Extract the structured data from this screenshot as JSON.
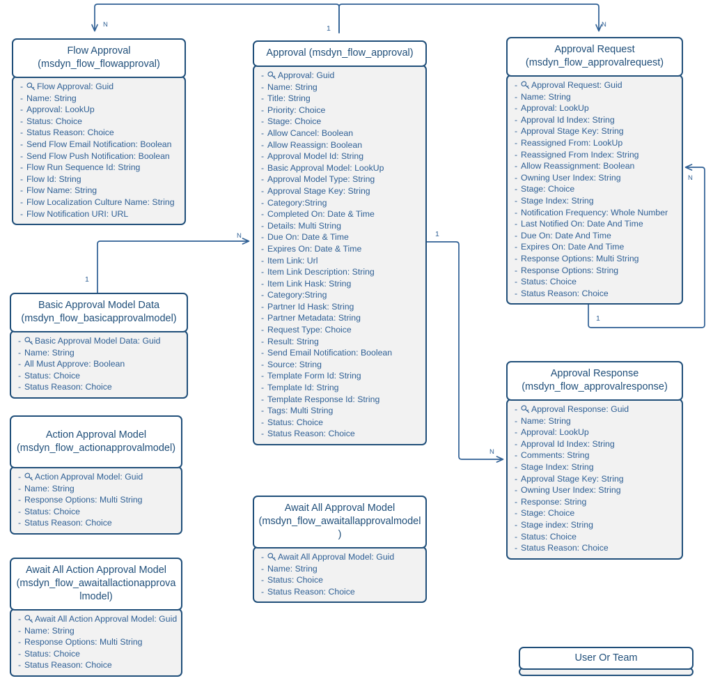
{
  "diagram": {
    "title": "Power Automate Approvals Dataverse ER Diagram",
    "colors": {
      "border": "#1F4E79",
      "header_bg": "#FFFFFF",
      "body_bg": "#F2F2F2",
      "text": "#2E5F94",
      "line": "#2E5F94"
    }
  },
  "entities": [
    {
      "id": "flow-approval",
      "title": "Flow Approval",
      "schema": "(msdyn_flow_flowapproval)",
      "attributes": [
        {
          "key": true,
          "text": "Flow Approval: Guid"
        },
        {
          "key": false,
          "text": "Name: String"
        },
        {
          "key": false,
          "text": "Approval: LookUp"
        },
        {
          "key": false,
          "text": "Status: Choice"
        },
        {
          "key": false,
          "text": "Status Reason: Choice"
        },
        {
          "key": false,
          "text": "Send Flow Email Notification: Boolean"
        },
        {
          "key": false,
          "text": "Send Flow Push Notification: Boolean"
        },
        {
          "key": false,
          "text": "Flow Run Sequence Id: String"
        },
        {
          "key": false,
          "text": "Flow Id: String"
        },
        {
          "key": false,
          "text": "Flow Name: String"
        },
        {
          "key": false,
          "text": "Flow Localization Culture Name: String"
        },
        {
          "key": false,
          "text": "Flow Notification URI: URL"
        }
      ]
    },
    {
      "id": "approval",
      "title": "Approval (msdyn_flow_approval)",
      "schema": "",
      "attributes": [
        {
          "key": true,
          "text": "Approval: Guid"
        },
        {
          "key": false,
          "text": "Name: String"
        },
        {
          "key": false,
          "text": "Title: String"
        },
        {
          "key": false,
          "text": "Priority: Choice"
        },
        {
          "key": false,
          "text": "Stage: Choice"
        },
        {
          "key": false,
          "text": "Allow Cancel: Boolean"
        },
        {
          "key": false,
          "text": "Allow Reassign: Boolean"
        },
        {
          "key": false,
          "text": "Approval Model Id: String"
        },
        {
          "key": false,
          "text": "Basic Approval Model: LookUp"
        },
        {
          "key": false,
          "text": "Approval Model Type: String"
        },
        {
          "key": false,
          "text": "Approval Stage Key: String"
        },
        {
          "key": false,
          "text": "Category:String"
        },
        {
          "key": false,
          "text": "Completed On: Date & Time"
        },
        {
          "key": false,
          "text": "Details: Multi String"
        },
        {
          "key": false,
          "text": "Due On: Date & Time"
        },
        {
          "key": false,
          "text": "Expires On: Date & Time"
        },
        {
          "key": false,
          "text": "Item Link: Url"
        },
        {
          "key": false,
          "text": "Item Link Description: String"
        },
        {
          "key": false,
          "text": "Item Link Hask: String"
        },
        {
          "key": false,
          "text": "Category:String"
        },
        {
          "key": false,
          "text": "Partner Id Hask: String"
        },
        {
          "key": false,
          "text": "Partner Metadata: String"
        },
        {
          "key": false,
          "text": "Request Type: Choice"
        },
        {
          "key": false,
          "text": "Result: String"
        },
        {
          "key": false,
          "text": "Send Email Notification: Boolean"
        },
        {
          "key": false,
          "text": "Source: String"
        },
        {
          "key": false,
          "text": "Template Form Id: String"
        },
        {
          "key": false,
          "text": "Template Id: String"
        },
        {
          "key": false,
          "text": "Template Response Id: String"
        },
        {
          "key": false,
          "text": "Tags: Multi String"
        },
        {
          "key": false,
          "text": "Status: Choice"
        },
        {
          "key": false,
          "text": "Status Reason: Choice"
        }
      ]
    },
    {
      "id": "approval-request",
      "title": "Approval Request",
      "schema": "(msdyn_flow_approvalrequest)",
      "attributes": [
        {
          "key": true,
          "text": "Approval Request: Guid"
        },
        {
          "key": false,
          "text": "Name: String"
        },
        {
          "key": false,
          "text": "Approval: LookUp"
        },
        {
          "key": false,
          "text": "Approval Id Index: String"
        },
        {
          "key": false,
          "text": "Approval Stage Key: String"
        },
        {
          "key": false,
          "text": "Reassigned From: LookUp"
        },
        {
          "key": false,
          "text": "Reassigned From Index: String"
        },
        {
          "key": false,
          "text": "Allow Reassignment: Boolean"
        },
        {
          "key": false,
          "text": "Owning User Index: String"
        },
        {
          "key": false,
          "text": "Stage: Choice"
        },
        {
          "key": false,
          "text": "Stage Index: String"
        },
        {
          "key": false,
          "text": "Notification Frequency: Whole Number"
        },
        {
          "key": false,
          "text": "Last Notified On: Date And Time"
        },
        {
          "key": false,
          "text": "Due On: Date And Time"
        },
        {
          "key": false,
          "text": "Expires On: Date And Time"
        },
        {
          "key": false,
          "text": "Response Options: Multi String"
        },
        {
          "key": false,
          "text": "Response Options: String"
        },
        {
          "key": false,
          "text": "Status: Choice"
        },
        {
          "key": false,
          "text": "Status Reason: Choice"
        }
      ]
    },
    {
      "id": "basic-approval-model-data",
      "title": "Basic Approval Model Data",
      "schema": "(msdyn_flow_basicapprovalmodel)",
      "attributes": [
        {
          "key": true,
          "text": "Basic Approval Model Data: Guid"
        },
        {
          "key": false,
          "text": "Name: String"
        },
        {
          "key": false,
          "text": "All Must Approve: Boolean"
        },
        {
          "key": false,
          "text": "Status: Choice"
        },
        {
          "key": false,
          "text": "Status Reason: Choice"
        }
      ]
    },
    {
      "id": "action-approval-model",
      "title": "Action Approval Model",
      "schema": "(msdyn_flow_actionapprovalmodel)",
      "attributes": [
        {
          "key": true,
          "text": "Action Approval Model: Guid"
        },
        {
          "key": false,
          "text": "Name: String"
        },
        {
          "key": false,
          "text": "Response Options: Multi String"
        },
        {
          "key": false,
          "text": "Status: Choice"
        },
        {
          "key": false,
          "text": "Status Reason: Choice"
        }
      ]
    },
    {
      "id": "await-all-action-approval-model",
      "title": "Await All Action Approval Model",
      "schema": "(msdyn_flow_awaitallactionapprovalmodel)",
      "attributes": [
        {
          "key": true,
          "text": "Await All Action Approval Model: Guid"
        },
        {
          "key": false,
          "text": "Name: String"
        },
        {
          "key": false,
          "text": "Response Options: Multi String"
        },
        {
          "key": false,
          "text": "Status: Choice"
        },
        {
          "key": false,
          "text": "Status Reason: Choice"
        }
      ]
    },
    {
      "id": "await-all-approval-model",
      "title": "Await All Approval Model",
      "schema": "(msdyn_flow_awaitallapprovalmodel)",
      "attributes": [
        {
          "key": true,
          "text": "Await All Approval Model: Guid"
        },
        {
          "key": false,
          "text": "Name: String"
        },
        {
          "key": false,
          "text": "Status: Choice"
        },
        {
          "key": false,
          "text": "Status Reason: Choice"
        }
      ]
    },
    {
      "id": "approval-response",
      "title": "Approval Response",
      "schema": "(msdyn_flow_approvalresponse)",
      "attributes": [
        {
          "key": true,
          "text": "Approval Response: Guid"
        },
        {
          "key": false,
          "text": "Name: String"
        },
        {
          "key": false,
          "text": "Approval: LookUp"
        },
        {
          "key": false,
          "text": "Approval Id Index: String"
        },
        {
          "key": false,
          "text": "Comments: String"
        },
        {
          "key": false,
          "text": "Stage Index: String"
        },
        {
          "key": false,
          "text": "Approval Stage Key: String"
        },
        {
          "key": false,
          "text": "Owning User Index: String"
        },
        {
          "key": false,
          "text": "Response: String"
        },
        {
          "key": false,
          "text": "Stage: Choice"
        },
        {
          "key": false,
          "text": "Stage index: String"
        },
        {
          "key": false,
          "text": "Status: Choice"
        },
        {
          "key": false,
          "text": "Status Reason: Choice"
        }
      ]
    },
    {
      "id": "user-or-team",
      "title": "User Or Team",
      "schema": "",
      "attributes": []
    }
  ],
  "relationships": [
    {
      "id": "approval-to-flow-approval",
      "from": "approval",
      "to": "flow-approval",
      "from_card": "1",
      "to_card": "N"
    },
    {
      "id": "approval-to-approval-request",
      "from": "approval",
      "to": "approval-request",
      "from_card": "1",
      "to_card": "N"
    },
    {
      "id": "basic-model-to-approval",
      "from": "basic-approval-model-data",
      "to": "approval",
      "from_card": "1",
      "to_card": "N"
    },
    {
      "id": "approval-to-approval-response",
      "from": "approval",
      "to": "approval-response",
      "from_card": "1",
      "to_card": "N"
    },
    {
      "id": "approval-request-self-reassign",
      "from": "approval-request",
      "to": "approval-request",
      "from_card": "1",
      "to_card": "N"
    }
  ],
  "cardinality_labels": {
    "flow_approval_n": "N",
    "approval_top_1": "1",
    "approval_request_n": "N",
    "basic_model_1": "1",
    "approval_left_n": "N",
    "approval_right_1": "1",
    "approval_response_n": "N",
    "request_self_1": "1",
    "request_self_n": "N"
  }
}
